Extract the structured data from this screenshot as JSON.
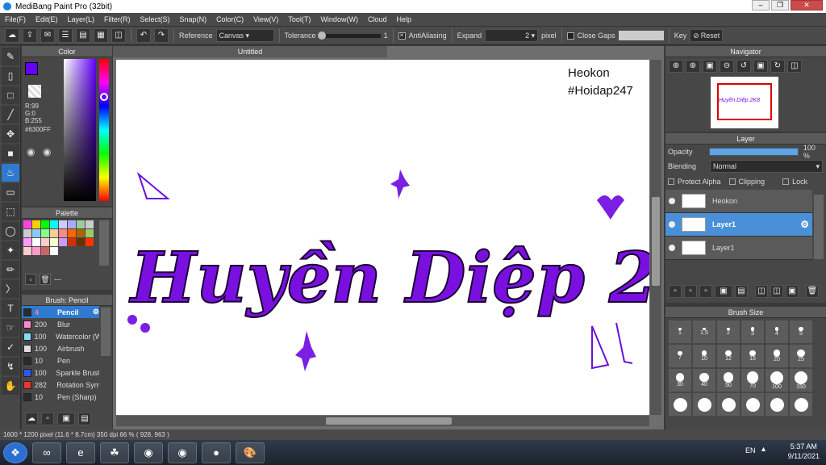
{
  "window": {
    "title": "MediBang Paint Pro (32bit)"
  },
  "menu": [
    "File(F)",
    "Edit(E)",
    "Layer(L)",
    "Filter(R)",
    "Select(S)",
    "Snap(N)",
    "Color(C)",
    "View(V)",
    "Tool(T)",
    "Window(W)",
    "Cloud",
    "Help"
  ],
  "toolbar": {
    "reference_label": "Reference",
    "reference_value": "Canvas",
    "tolerance_label": "Tolerance",
    "tolerance_value": "1",
    "antialias_label": "AntiAliasing",
    "expand_label": "Expand",
    "expand_value": "2",
    "expand_unit": "pixel",
    "closegaps_label": "Close Gaps",
    "key_label": "Key",
    "reset_label": "Reset"
  },
  "color_panel": {
    "title": "Color",
    "r": "R:99",
    "g": "G:0",
    "b": "B:255",
    "hex": "#6300FF",
    "primary": "#6300FF"
  },
  "palette_panel": {
    "title": "Palette",
    "swatches": [
      "#f4d",
      "#fc0",
      "#0f0",
      "#0ff",
      "#ccf",
      "#aaf",
      "#9c9",
      "#ccc",
      "#ccc",
      "#8cf",
      "#8f8",
      "#fc9",
      "#f88",
      "#f60",
      "#a60",
      "#9c6",
      "#f9f",
      "#fff",
      "#fcc",
      "#ffc",
      "#c9f",
      "#c30",
      "#630",
      "#f30",
      "#fcc",
      "#f9c",
      "#c66",
      "#fff"
    ],
    "dash": "---"
  },
  "brush_panel": {
    "title": "Brush: Pencil",
    "items": [
      {
        "size": "4",
        "name": "Pencil",
        "color": "#2b2b2b"
      },
      {
        "size": "200",
        "name": "Blur",
        "color": "#ff88cc"
      },
      {
        "size": "100",
        "name": "Watercolor (W",
        "color": "#88ddff"
      },
      {
        "size": "100",
        "name": "Airbrush",
        "color": "#dddddd"
      },
      {
        "size": "10",
        "name": "Pen",
        "color": "#2b2b2b"
      },
      {
        "size": "100",
        "name": "Sparkle Brush",
        "color": "#3355ff"
      },
      {
        "size": "282",
        "name": "Rotation Sym",
        "color": "#ee3333"
      },
      {
        "size": "10",
        "name": "Pen (Sharp)",
        "color": "#2b2b2b"
      }
    ]
  },
  "document": {
    "tab": "Untitled"
  },
  "canvas": {
    "watermark_line1": "Heokon",
    "watermark_line2": "#Hoidap247",
    "art_text": "Huyền Diệp 2K8",
    "art_color": "#7a10e0"
  },
  "navigator": {
    "title": "Navigator"
  },
  "layer_panel": {
    "title": "Layer",
    "opacity_label": "Opacity",
    "opacity_value": "100 %",
    "opacity_fraction": 1.0,
    "blending_label": "Blending",
    "blending_value": "Normal",
    "protect_alpha": "Protect Alpha",
    "clipping": "Clipping",
    "lock": "Lock",
    "layers": [
      {
        "name": "Heokon",
        "selected": false
      },
      {
        "name": "Layer1",
        "selected": true
      },
      {
        "name": "Layer1",
        "selected": false
      }
    ]
  },
  "brush_size": {
    "title": "Brush Size",
    "sizes": [
      "1",
      "1.5",
      "2",
      "3",
      "4",
      "5",
      "7",
      "10",
      "12",
      "15",
      "20",
      "25",
      "30",
      "40",
      "50",
      "70",
      "100",
      "150"
    ]
  },
  "status": {
    "text": "1600 * 1200 pixel  (11.6 * 8.7cm)  350 dpi  66 %  ( 928, 963 )"
  },
  "taskbar": {
    "lang": "EN",
    "time": "5:37 AM",
    "date": "9/11/2021"
  }
}
